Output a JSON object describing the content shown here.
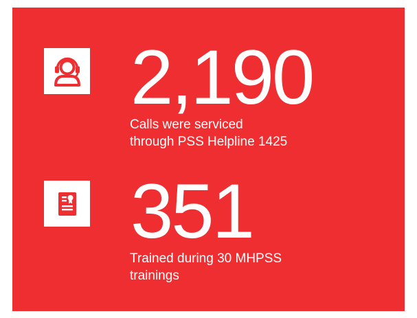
{
  "colors": {
    "panel_background": "#ee2e31",
    "icon_background": "#ffffff",
    "text": "#ffffff"
  },
  "stats": [
    {
      "icon": "headset-user-icon",
      "value": "2,190",
      "caption": "Calls were serviced through PSS Helpline 1425"
    },
    {
      "icon": "certificate-icon",
      "value": "351",
      "caption": "Trained during 30 MHPSS trainings"
    }
  ]
}
